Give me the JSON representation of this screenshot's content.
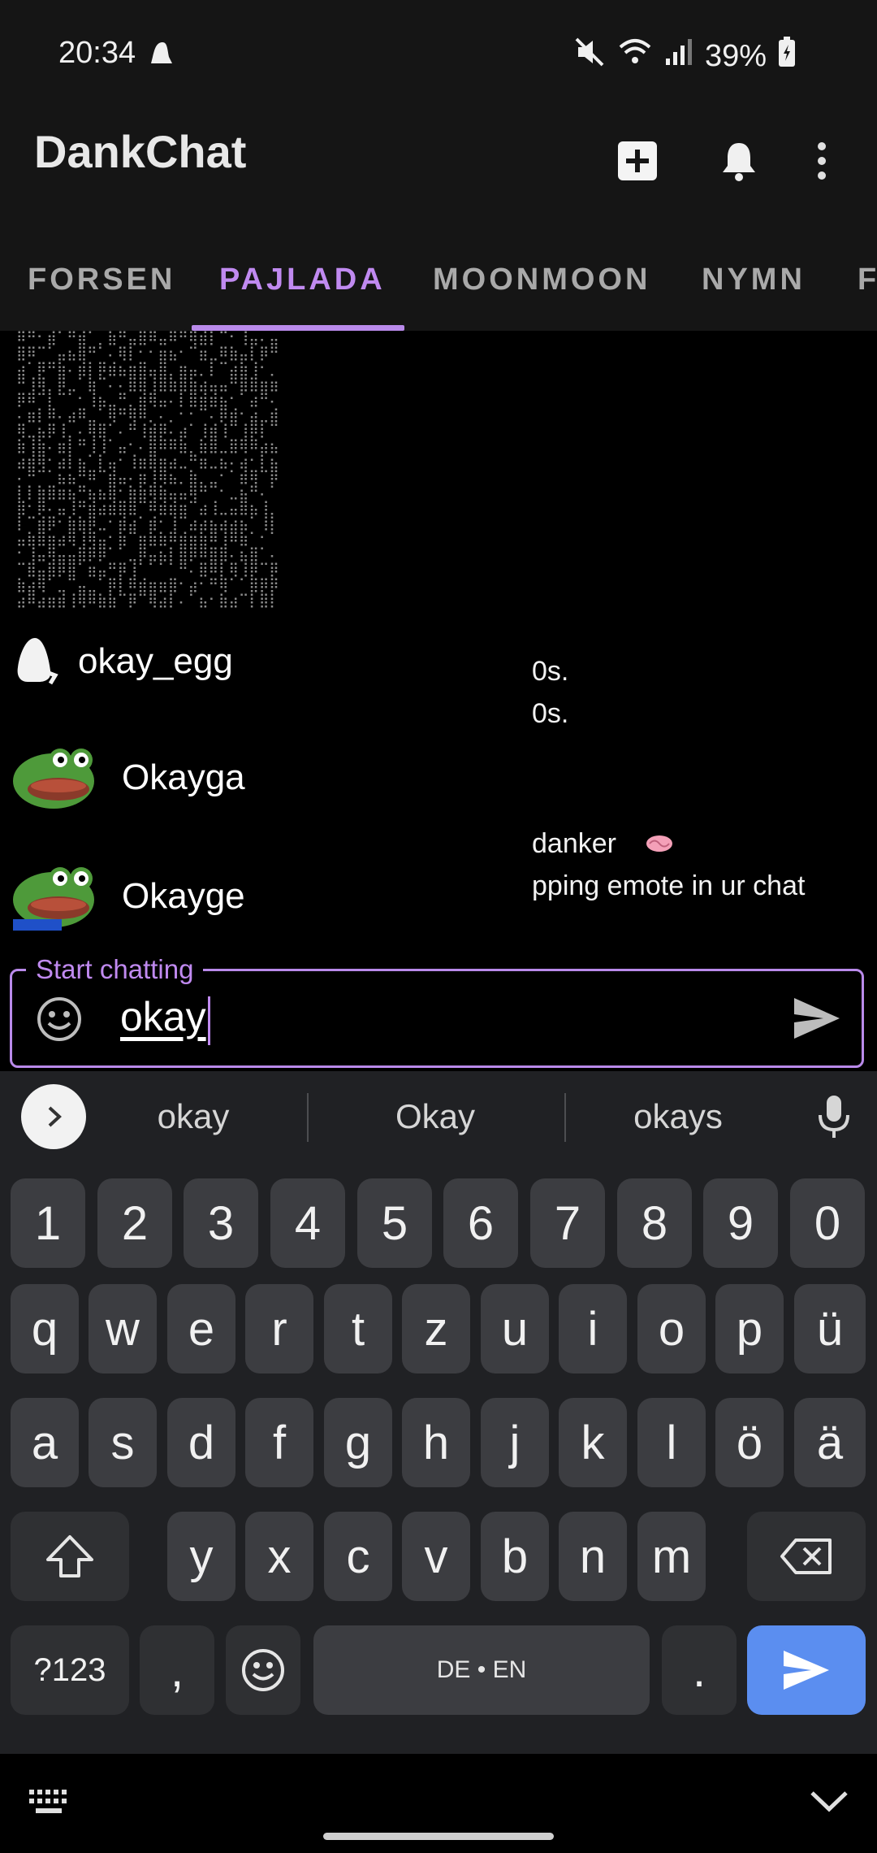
{
  "status": {
    "time": "20:34",
    "battery": "39%"
  },
  "app": {
    "title": "DankChat"
  },
  "tabs": [
    "FORSEN",
    "PAJLADA",
    "MOONMOON",
    "NYMN",
    "F"
  ],
  "chat": {
    "lines": [
      "0s.",
      "0s.",
      "danker",
      "pping emote in ur chat"
    ]
  },
  "suggestions": [
    {
      "label": "okay_egg",
      "icon": "egg-emote-icon"
    },
    {
      "label": "Okayga",
      "icon": "pepe-emote-icon"
    },
    {
      "label": "Okayge",
      "icon": "pepe-emote-icon"
    }
  ],
  "input": {
    "hint": "Start chatting",
    "value": "okay"
  },
  "keyboard": {
    "suggestions": [
      "okay",
      "Okay",
      "okays"
    ],
    "row_numbers": [
      "1",
      "2",
      "3",
      "4",
      "5",
      "6",
      "7",
      "8",
      "9",
      "0"
    ],
    "row1": [
      "q",
      "w",
      "e",
      "r",
      "t",
      "z",
      "u",
      "i",
      "o",
      "p",
      "ü"
    ],
    "row2": [
      "a",
      "s",
      "d",
      "f",
      "g",
      "h",
      "j",
      "k",
      "l",
      "ö",
      "ä"
    ],
    "row3": [
      "y",
      "x",
      "c",
      "v",
      "b",
      "n",
      "m"
    ],
    "symbols": "?123",
    "comma": ",",
    "period": ".",
    "space_label": "DE • EN"
  },
  "colors": {
    "accent": "#b98aea",
    "send_key": "#5b8ef0",
    "background": "#000000",
    "keyboard": "#202124"
  }
}
